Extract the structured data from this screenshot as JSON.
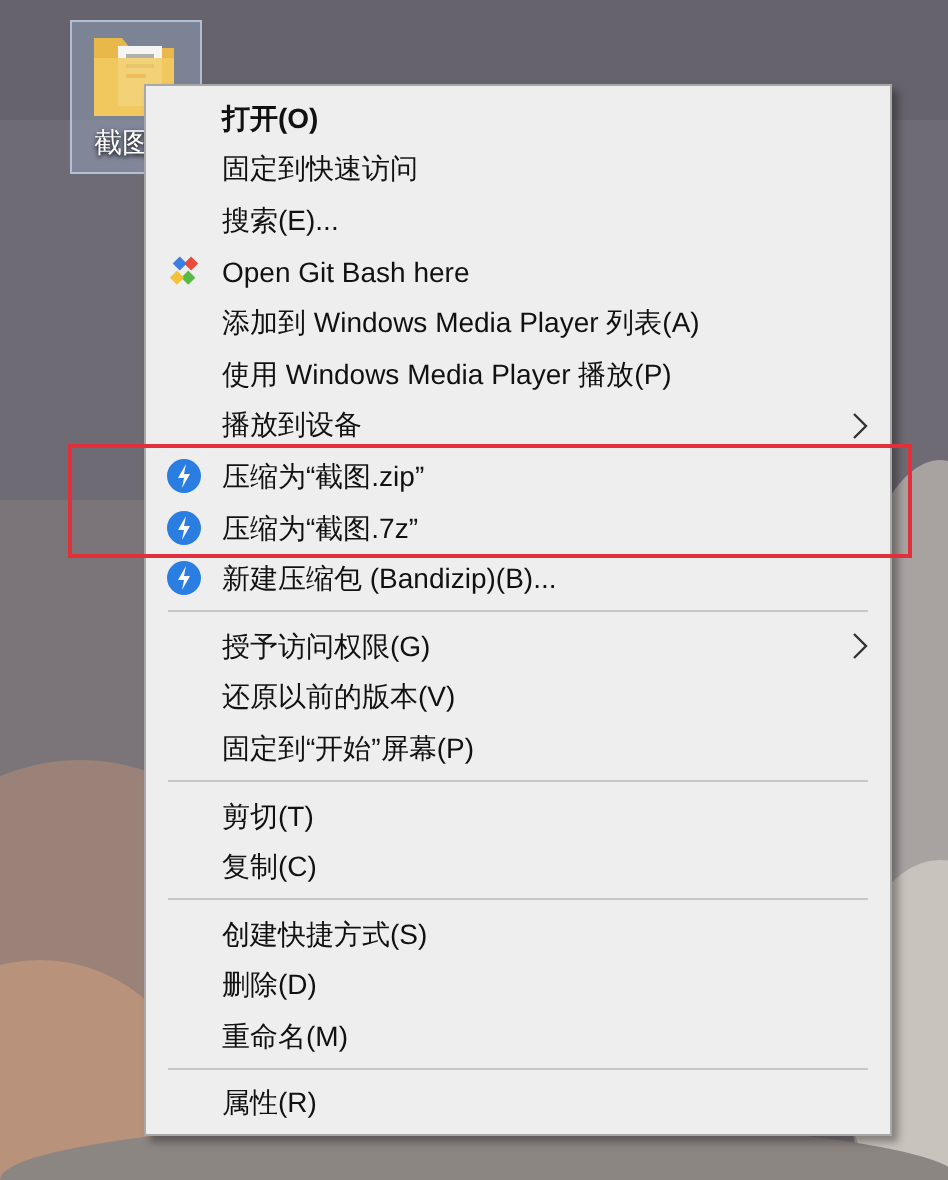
{
  "desktop": {
    "icon": {
      "label": "截图",
      "selected": true
    }
  },
  "context_menu": {
    "items": [
      {
        "kind": "item",
        "label": "打开(O)",
        "default": true,
        "submenu": false,
        "highlighted": false
      },
      {
        "kind": "item",
        "label": "固定到快速访问",
        "default": false,
        "submenu": false,
        "highlighted": false
      },
      {
        "kind": "item",
        "label": "搜索(E)...",
        "default": false,
        "submenu": false,
        "highlighted": false
      },
      {
        "kind": "git-item",
        "label": "Open Git Bash here",
        "default": false,
        "submenu": false,
        "highlighted": false
      },
      {
        "kind": "item",
        "label": "添加到 Windows Media Player 列表(A)",
        "default": false,
        "submenu": false,
        "highlighted": false
      },
      {
        "kind": "item",
        "label": "使用 Windows Media Player 播放(P)",
        "default": false,
        "submenu": false,
        "highlighted": false
      },
      {
        "kind": "item",
        "label": "播放到设备",
        "default": false,
        "submenu": true,
        "highlighted": false
      },
      {
        "kind": "zip-item",
        "label": "压缩为“截图.zip”",
        "default": false,
        "submenu": false,
        "highlighted": true
      },
      {
        "kind": "zip-item",
        "label": "压缩为“截图.7z”",
        "default": false,
        "submenu": false,
        "highlighted": true
      },
      {
        "kind": "zip-item",
        "label": "新建压缩包 (Bandizip)(B)...",
        "default": false,
        "submenu": false,
        "highlighted": false
      },
      {
        "kind": "separator"
      },
      {
        "kind": "item",
        "label": "授予访问权限(G)",
        "default": false,
        "submenu": true,
        "highlighted": false
      },
      {
        "kind": "item",
        "label": "还原以前的版本(V)",
        "default": false,
        "submenu": false,
        "highlighted": false
      },
      {
        "kind": "item",
        "label": "固定到“开始”屏幕(P)",
        "default": false,
        "submenu": false,
        "highlighted": false
      },
      {
        "kind": "separator"
      },
      {
        "kind": "item",
        "label": "剪切(T)",
        "default": false,
        "submenu": false,
        "highlighted": false
      },
      {
        "kind": "item",
        "label": "复制(C)",
        "default": false,
        "submenu": false,
        "highlighted": false
      },
      {
        "kind": "separator"
      },
      {
        "kind": "item",
        "label": "创建快捷方式(S)",
        "default": false,
        "submenu": false,
        "highlighted": false
      },
      {
        "kind": "item",
        "label": "删除(D)",
        "default": false,
        "submenu": false,
        "highlighted": false
      },
      {
        "kind": "item",
        "label": "重命名(M)",
        "default": false,
        "submenu": false,
        "highlighted": false
      },
      {
        "kind": "separator"
      },
      {
        "kind": "item",
        "label": "属性(R)",
        "default": false,
        "submenu": false,
        "highlighted": false
      }
    ]
  }
}
